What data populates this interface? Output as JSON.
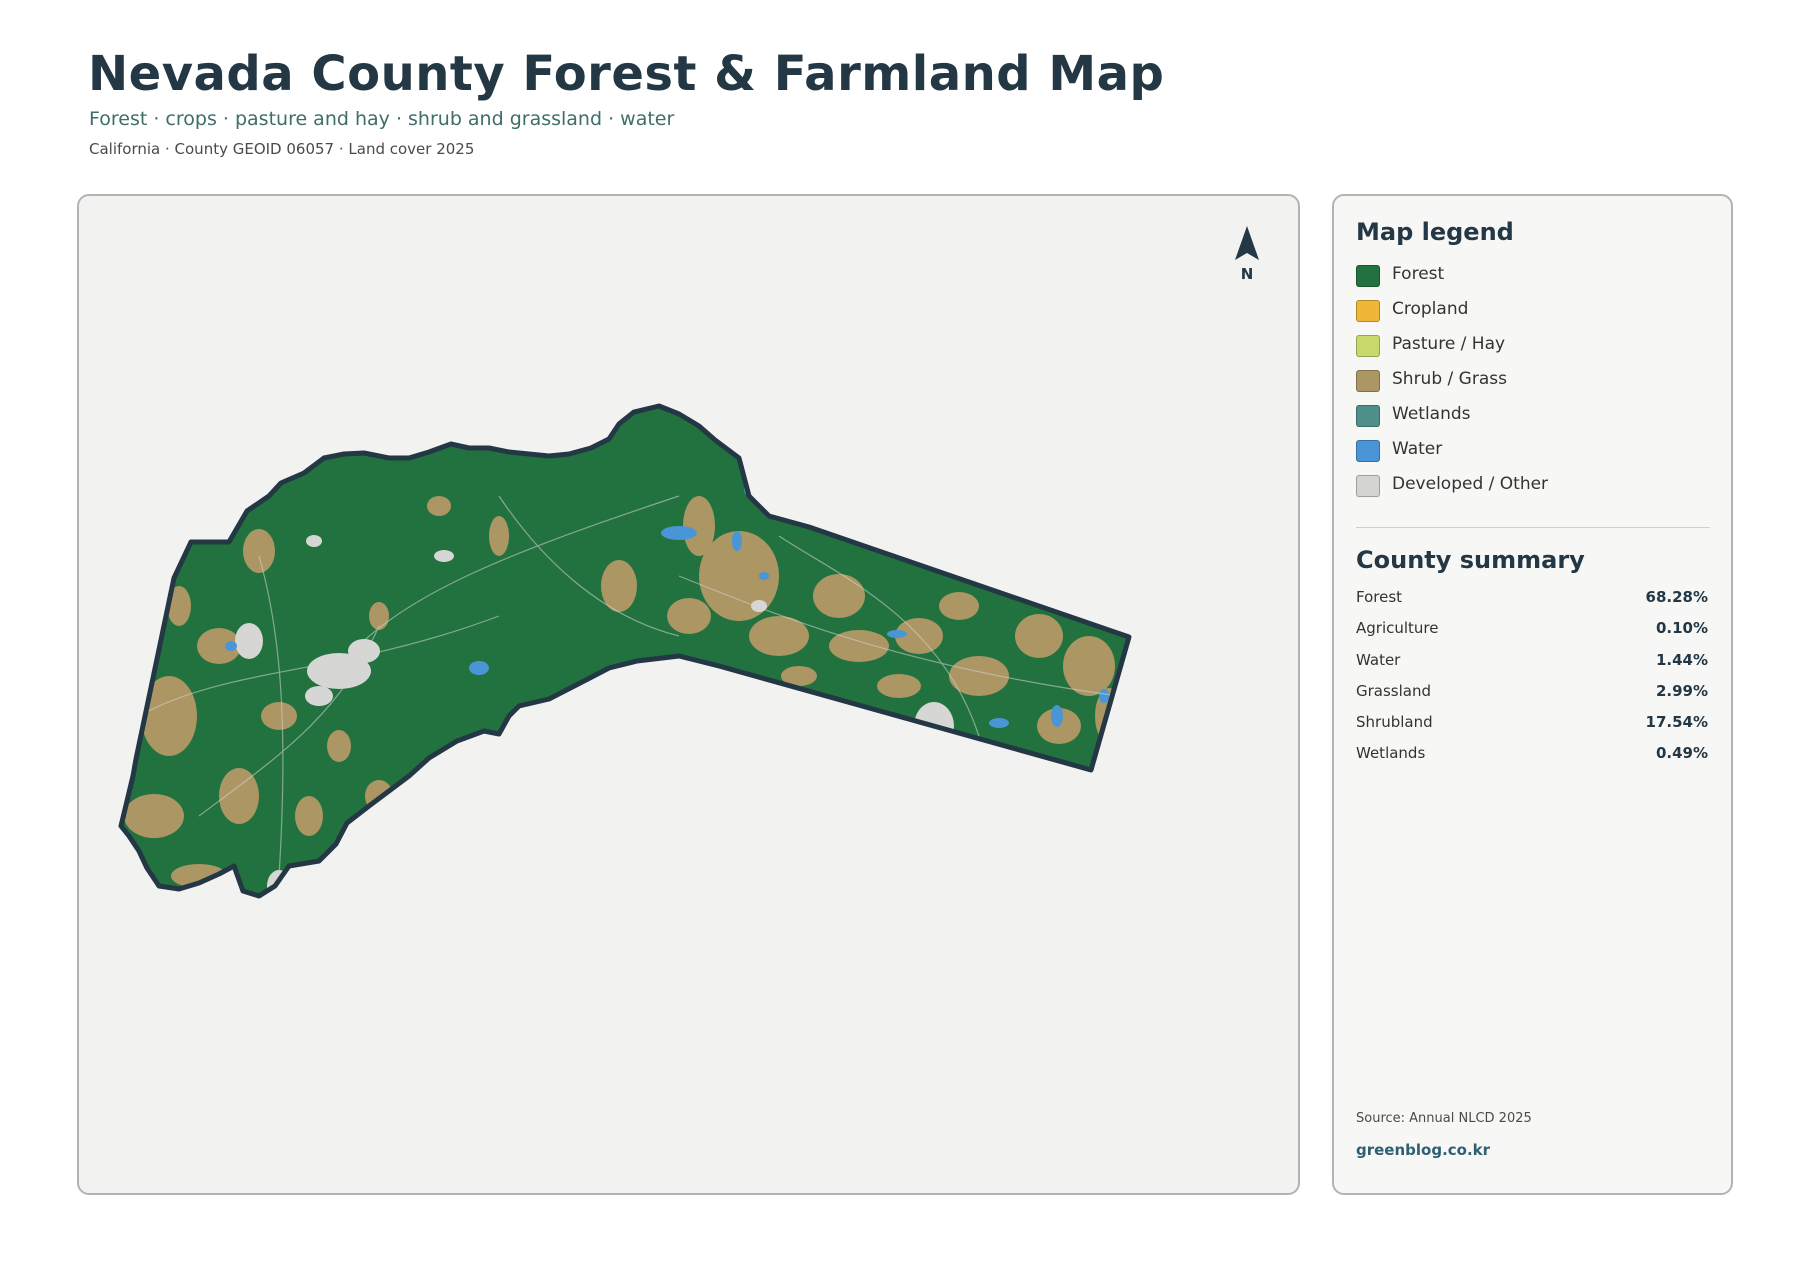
{
  "header": {
    "title": "Nevada County Forest & Farmland Map",
    "subtitle": "Forest · crops · pasture and hay · shrub and grassland · water",
    "meta": "California · County GEOID 06057 · Land cover 2025"
  },
  "map": {
    "north_label": "N",
    "colors": {
      "forest": "#22723f",
      "shrub": "#ab9664",
      "water": "#4a95d6",
      "developed": "#d6d6d4",
      "outline": "#233744",
      "background": "#f2f2f1"
    }
  },
  "legend": {
    "title": "Map legend",
    "items": [
      {
        "label": "Forest",
        "color": "#22723f"
      },
      {
        "label": "Cropland",
        "color": "#efb638"
      },
      {
        "label": "Pasture / Hay",
        "color": "#c9d86a"
      },
      {
        "label": "Shrub / Grass",
        "color": "#ab9664"
      },
      {
        "label": "Wetlands",
        "color": "#4e8f8a"
      },
      {
        "label": "Water",
        "color": "#4a95d6"
      },
      {
        "label": "Developed / Other",
        "color": "#d4d4d2"
      }
    ]
  },
  "summary": {
    "title": "County summary",
    "rows": [
      {
        "name": "Forest",
        "value": "68.28%"
      },
      {
        "name": "Agriculture",
        "value": "0.10%"
      },
      {
        "name": "Water",
        "value": "1.44%"
      },
      {
        "name": "Grassland",
        "value": "2.99%"
      },
      {
        "name": "Shrubland",
        "value": "17.54%"
      },
      {
        "name": "Wetlands",
        "value": "0.49%"
      }
    ]
  },
  "footer": {
    "source": "Source: Annual NLCD 2025",
    "brand": "greenblog.co.kr"
  }
}
